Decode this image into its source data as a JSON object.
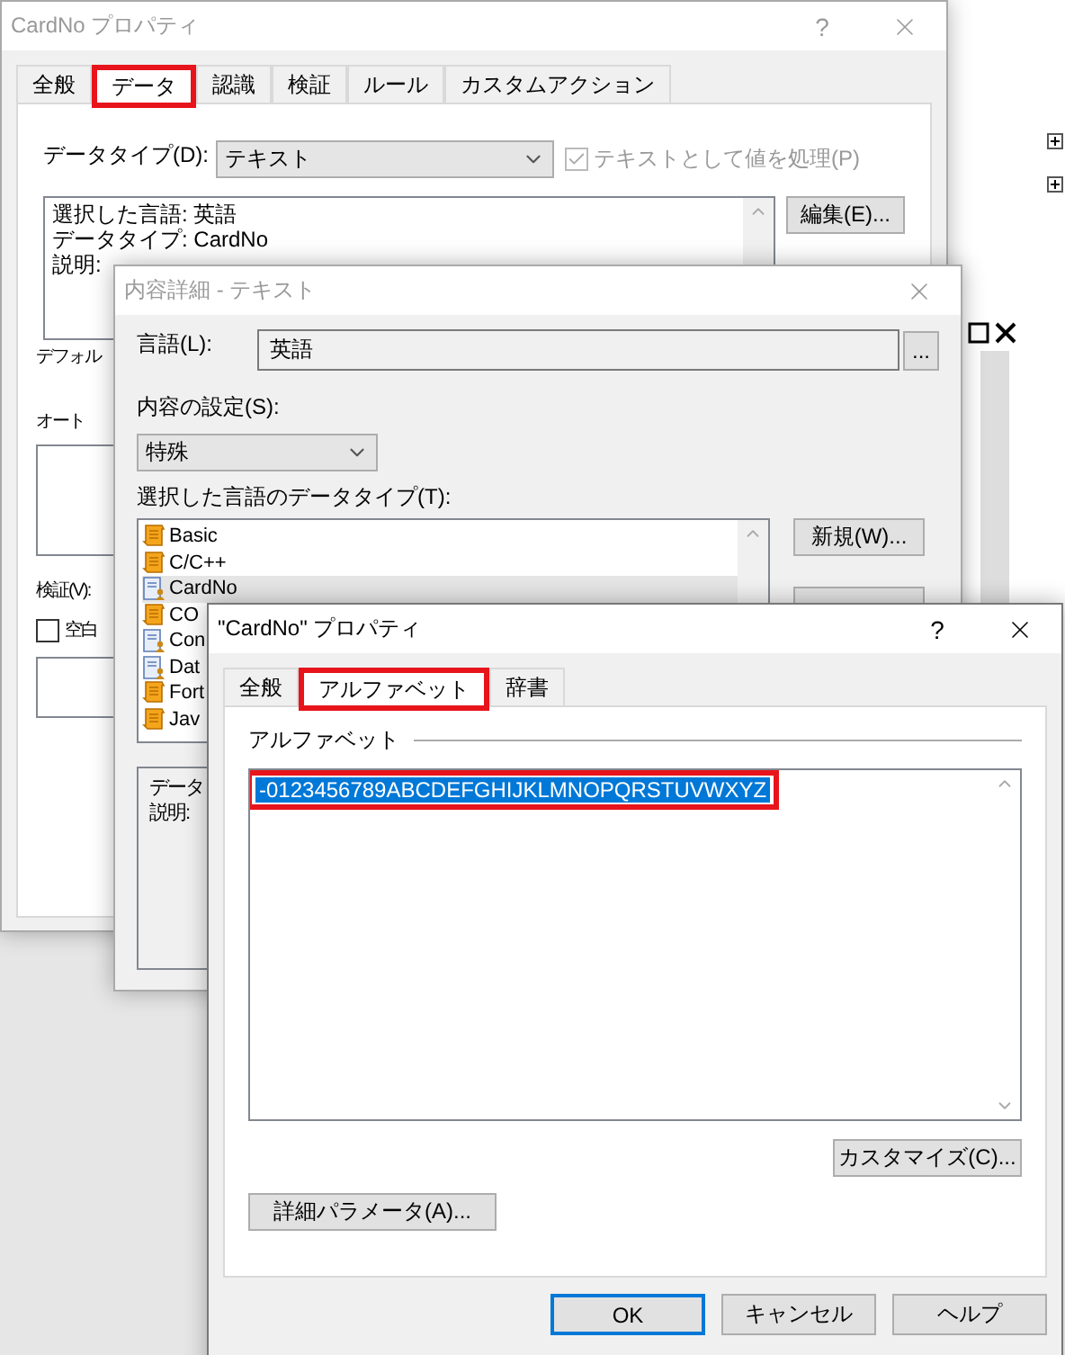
{
  "properties_window": {
    "title": "CardNo プロパティ",
    "help": "?",
    "active": false,
    "tabs": [
      {
        "label": "全般",
        "selected": false,
        "highlighted": false
      },
      {
        "label": "データ",
        "selected": true,
        "highlighted": true
      },
      {
        "label": "認識",
        "selected": false,
        "highlighted": false
      },
      {
        "label": "検証",
        "selected": false,
        "highlighted": false
      },
      {
        "label": "ルール",
        "selected": false,
        "highlighted": false
      },
      {
        "label": "カスタムアクション",
        "selected": false,
        "highlighted": false
      }
    ],
    "data_type_label": "データタイプ(D):",
    "data_type_value": "テキスト",
    "treat_as_text": {
      "label": "テキストとして値を処理(P)",
      "checked": true,
      "disabled": true
    },
    "summary_lines": [
      "選択した言語: 英語",
      "データタイプ: CardNo",
      "説明:"
    ],
    "edit_button": "編集(E)...",
    "default_label": "デフォル",
    "autocorrect_label": "オート",
    "validation_label": "検証(V):",
    "blank_checkbox": {
      "label": "空白",
      "checked": false
    }
  },
  "detail_window": {
    "title": "内容詳細 - テキスト",
    "active": false,
    "language_label": "言語(L):",
    "language_value": "英語",
    "browse_button": "...",
    "content_label": "内容の設定(S):",
    "content_value": "特殊",
    "types_label": "選択した言語のデータタイプ(T):",
    "types": [
      {
        "label": "Basic",
        "kind": "builtin",
        "selected": false
      },
      {
        "label": "C/C++",
        "kind": "builtin",
        "selected": false
      },
      {
        "label": "CardNo",
        "kind": "custom",
        "selected": true
      },
      {
        "label": "CO",
        "kind": "builtin",
        "selected": false
      },
      {
        "label": "Con",
        "kind": "custom",
        "selected": false
      },
      {
        "label": "Dat",
        "kind": "custom",
        "selected": false
      },
      {
        "label": "Fort",
        "kind": "builtin",
        "selected": false
      },
      {
        "label": "Jav",
        "kind": "builtin",
        "selected": false
      }
    ],
    "new_button": "新規(W)...",
    "info_lines": [
      "データ",
      "説明:"
    ]
  },
  "alphabet_window": {
    "title": "\"CardNo\" プロパティ",
    "help": "?",
    "active": true,
    "tabs": [
      {
        "label": "全般",
        "selected": false,
        "highlighted": false
      },
      {
        "label": "アルファベット",
        "selected": true,
        "highlighted": true
      },
      {
        "label": "辞書",
        "selected": false,
        "highlighted": false
      }
    ],
    "group_label": "アルファベット",
    "alphabet": {
      "value": "-0123456789ABCDEFGHIJKLMNOPQRSTUVWXYZ",
      "selected": true,
      "highlighted": true
    },
    "customize_button": "カスタマイズ(C)...",
    "advanced_button": "詳細パラメータ(A)...",
    "buttons": [
      {
        "label": "OK",
        "default": true
      },
      {
        "label": "キャンセル",
        "default": false
      },
      {
        "label": "ヘルプ",
        "default": false
      }
    ]
  }
}
